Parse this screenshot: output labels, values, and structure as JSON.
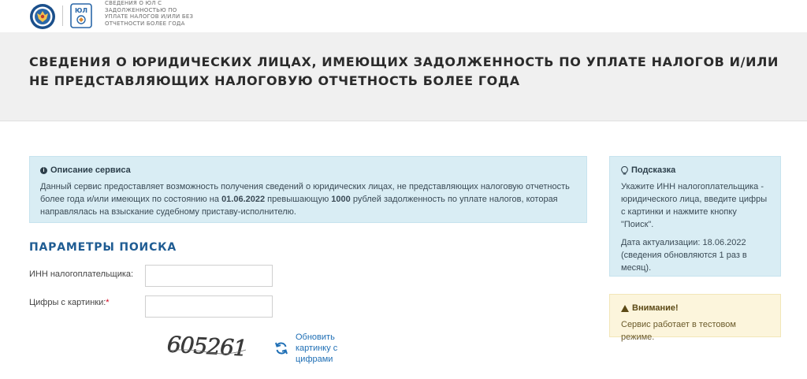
{
  "header": {
    "service_name_small": "СВЕДЕНИЯ О ЮЛ С ЗАДОЛЖЕННОСТЬЮ ПО УПЛАТЕ НАЛОГОВ И/ИЛИ БЕЗ ОТЧЕТНОСТИ БОЛЕЕ ГОДА",
    "ul_logo_text": "ЮЛ"
  },
  "page": {
    "title": "СВЕДЕНИЯ О ЮРИДИЧЕСКИХ ЛИЦАХ, ИМЕЮЩИХ ЗАДОЛЖЕННОСТЬ ПО УПЛАТЕ НАЛОГОВ И/ИЛИ НЕ ПРЕДСТАВЛЯЮЩИХ НАЛОГОВУЮ ОТЧЕТНОСТЬ БОЛЕЕ ГОДА"
  },
  "description": {
    "title": "Описание сервиса",
    "text_1": "Данный сервис предоставляет возможность получения сведений о юридических лицах, не представляющих налоговую отчетность более года и/или имеющих по состоянию на ",
    "date": "01.06.2022",
    "text_2": " превышающую ",
    "amount": "1000",
    "text_3": " рублей задолженность по уплате налогов, которая направлялась на взыскание судебному приставу-исполнителю."
  },
  "hint": {
    "title": "Подсказка",
    "text": "Укажите ИНН налогоплательщика - юридического лица, введите цифры с картинки и нажмите кнопку \"Поиск\".",
    "update": "Дата актуализации: 18.06.2022 (сведения обновляются 1 раз в месяц)."
  },
  "warning": {
    "title": "Внимание!",
    "text": "Сервис работает в тестовом режиме."
  },
  "search": {
    "title": "ПАРАМЕТРЫ ПОИСКА",
    "inn_label": "ИНН налогоплательщика:",
    "inn_value": "",
    "captcha_label": "Цифры с картинки:",
    "captcha_required": "*",
    "captcha_value": "",
    "captcha_image_text": "605261",
    "refresh_label": "Обновить картинку с цифрами"
  },
  "colors": {
    "accent": "#1f5c93",
    "info_bg": "#d9edf4",
    "warn_bg": "#fcf5dc"
  }
}
